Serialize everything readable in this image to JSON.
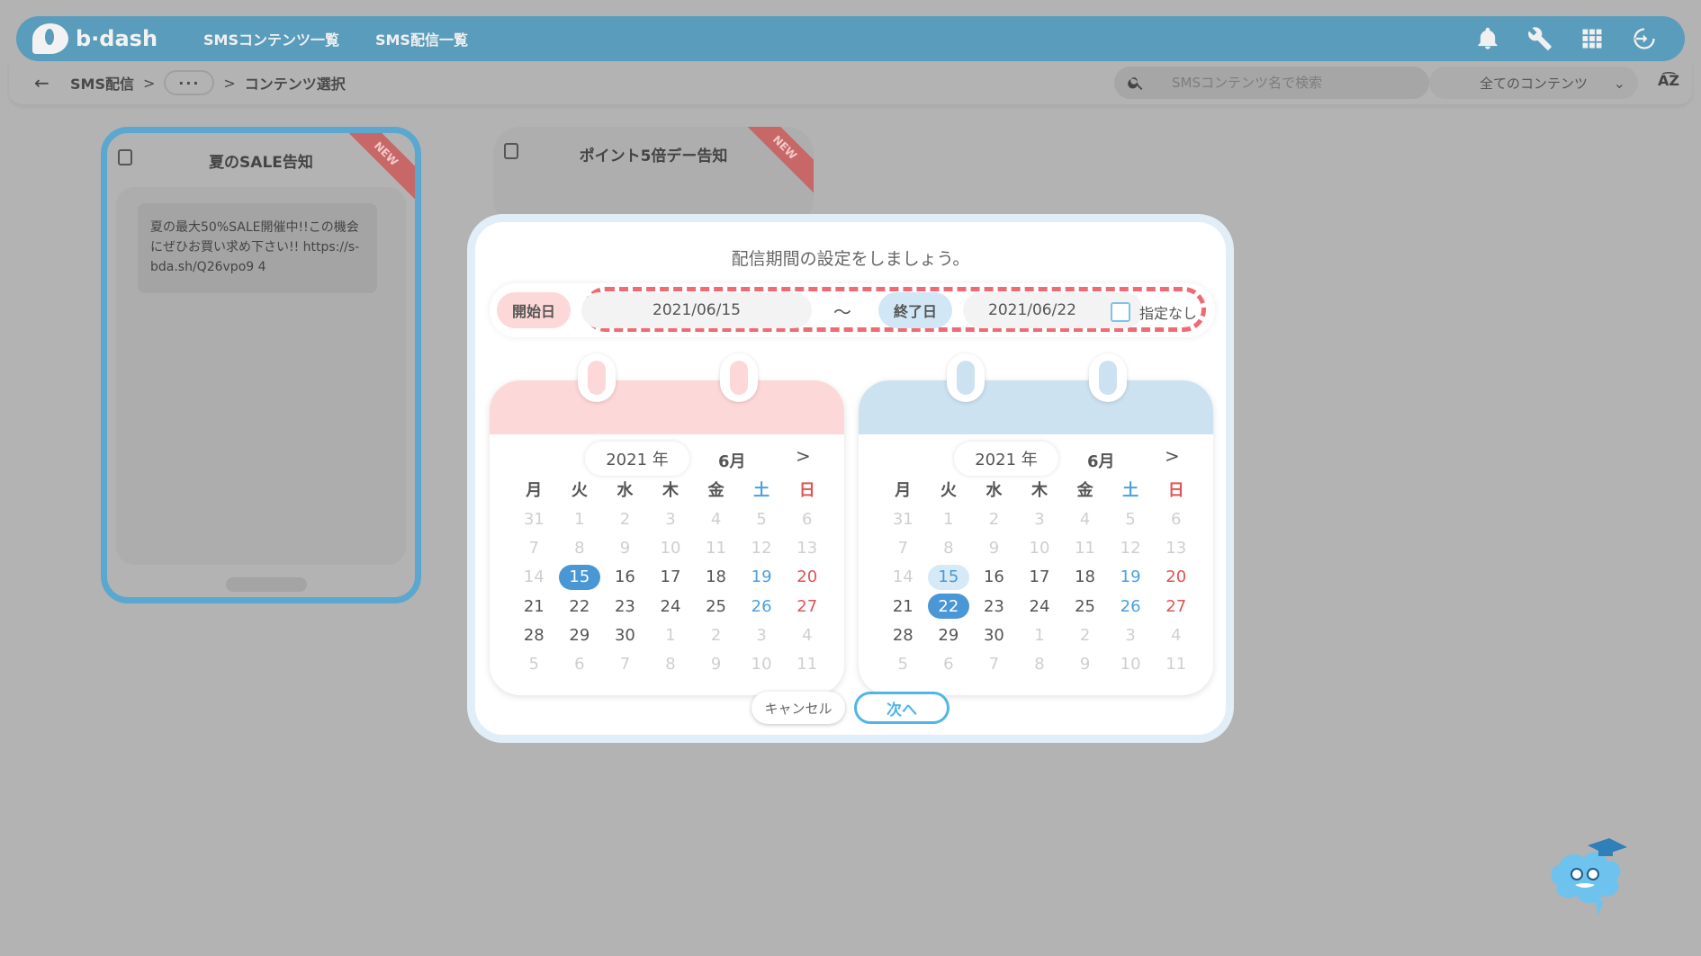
{
  "header": {
    "logo_text": "b·dash",
    "nav": [
      "SMSコンテンツ一覧",
      "SMS配信一覧"
    ],
    "icons": [
      "bell-icon",
      "wrench-icon",
      "grid-icon",
      "logout-icon"
    ]
  },
  "subbar": {
    "back": "←",
    "crumbs": [
      "SMS配信",
      "コンテンツ選択"
    ],
    "separator": ">",
    "more": "···",
    "search_placeholder": "SMSコンテンツ名で検索",
    "filter_value": "全てのコンテンツ",
    "sort_label": "A͡Z"
  },
  "cards": [
    {
      "title": "夏のSALE告知",
      "badge": "NEW",
      "message": "夏の最大50%SALE開催中!!この機会にぜひお買い求め下さい!! https://s-bda.sh/Q26vpo9 4"
    },
    {
      "title": "ポイント5倍デー告知",
      "badge": "NEW"
    }
  ],
  "modal": {
    "title": "配信期間の設定をしましょう。",
    "start_label": "開始日",
    "start_date": "2021/06/15",
    "tilde": "〜",
    "end_label": "終了日",
    "end_date": "2021/06/22",
    "unspecified_label": "指定なし",
    "cancel_label": "キャンセル",
    "next_label": "次へ"
  },
  "calendar_left": {
    "year": "2021 年",
    "month": "6月",
    "next": ">",
    "weekdays": [
      "月",
      "火",
      "水",
      "木",
      "金",
      "土",
      "日"
    ],
    "selected_day": "15"
  },
  "calendar_right": {
    "year": "2021 年",
    "month": "6月",
    "next": ">",
    "weekdays": [
      "月",
      "火",
      "水",
      "木",
      "金",
      "土",
      "日"
    ],
    "range_start_day": "15",
    "selected_day": "22"
  },
  "calendar_days": [
    [
      "31",
      "1",
      "2",
      "3",
      "4",
      "5",
      "6"
    ],
    [
      "7",
      "8",
      "9",
      "10",
      "11",
      "12",
      "13"
    ],
    [
      "14",
      "15",
      "16",
      "17",
      "18",
      "19",
      "20"
    ],
    [
      "21",
      "22",
      "23",
      "24",
      "25",
      "26",
      "27"
    ],
    [
      "28",
      "29",
      "30",
      "1",
      "2",
      "3",
      "4"
    ],
    [
      "5",
      "6",
      "7",
      "8",
      "9",
      "10",
      "11"
    ]
  ],
  "colors": {
    "header": "#5a9cbc",
    "accent": "#4fb6e6",
    "dash": "#ee6b73",
    "start_pill": "#fdd8d8",
    "end_pill": "#d1e7f6"
  }
}
